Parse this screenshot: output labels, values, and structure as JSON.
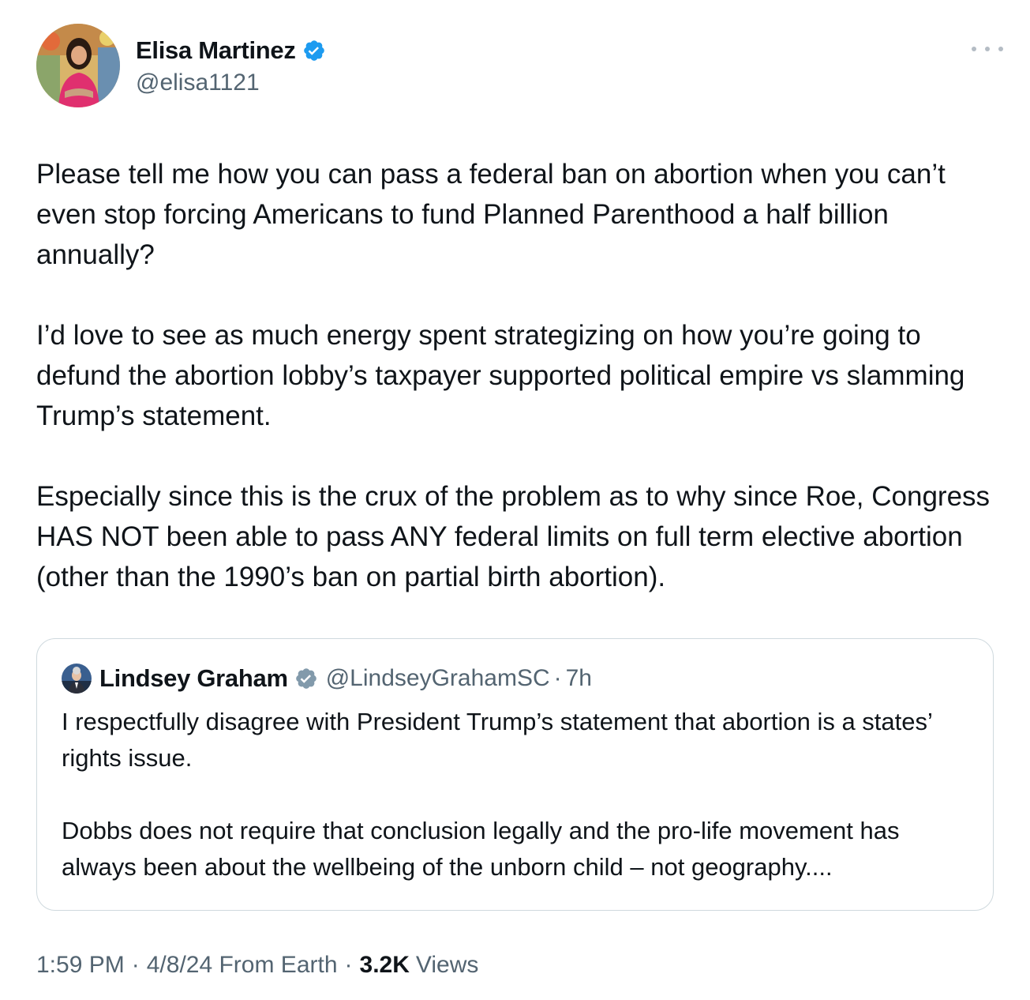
{
  "author": {
    "display_name": "Elisa Martinez",
    "handle": "@elisa1121",
    "verified": true
  },
  "tweet": {
    "paragraphs": [
      "Please tell me how you can pass a federal ban on abortion when you can’t even stop forcing Americans to fund Planned Parenthood a half billion annually?",
      "I’d love to see as much energy spent strategizing on how you’re going to defund the abortion lobby’s taxpayer supported political empire vs slamming Trump’s statement.",
      "Especially since this is the crux of the problem as to why since Roe, Congress HAS NOT been able to pass ANY federal limits on full term elective abortion (other than the 1990’s ban on partial birth abortion)."
    ]
  },
  "quote": {
    "display_name": "Lindsey Graham",
    "handle": "@LindseyGrahamSC",
    "dot": "·",
    "time": "7h",
    "verified": true,
    "verified_color": "#829aab",
    "paragraphs": [
      "I respectfully disagree with President Trump’s statement that abortion is a states’ rights issue.",
      "Dobbs does not require that conclusion legally and the pro-life movement has always been about the wellbeing of the unborn child – not geography...."
    ]
  },
  "meta": {
    "time": "1:59 PM",
    "sep1": "·",
    "date": "4/8/24 From Earth",
    "sep2": "·",
    "views_count": "3.2K",
    "views_label": "Views"
  },
  "icons": {
    "verified_badge": "verified-badge-icon",
    "more": "more-horizontal-icon"
  },
  "colors": {
    "verified_blue": "#1d9bf0",
    "secondary_text": "#536471",
    "border": "#cfd9de"
  }
}
